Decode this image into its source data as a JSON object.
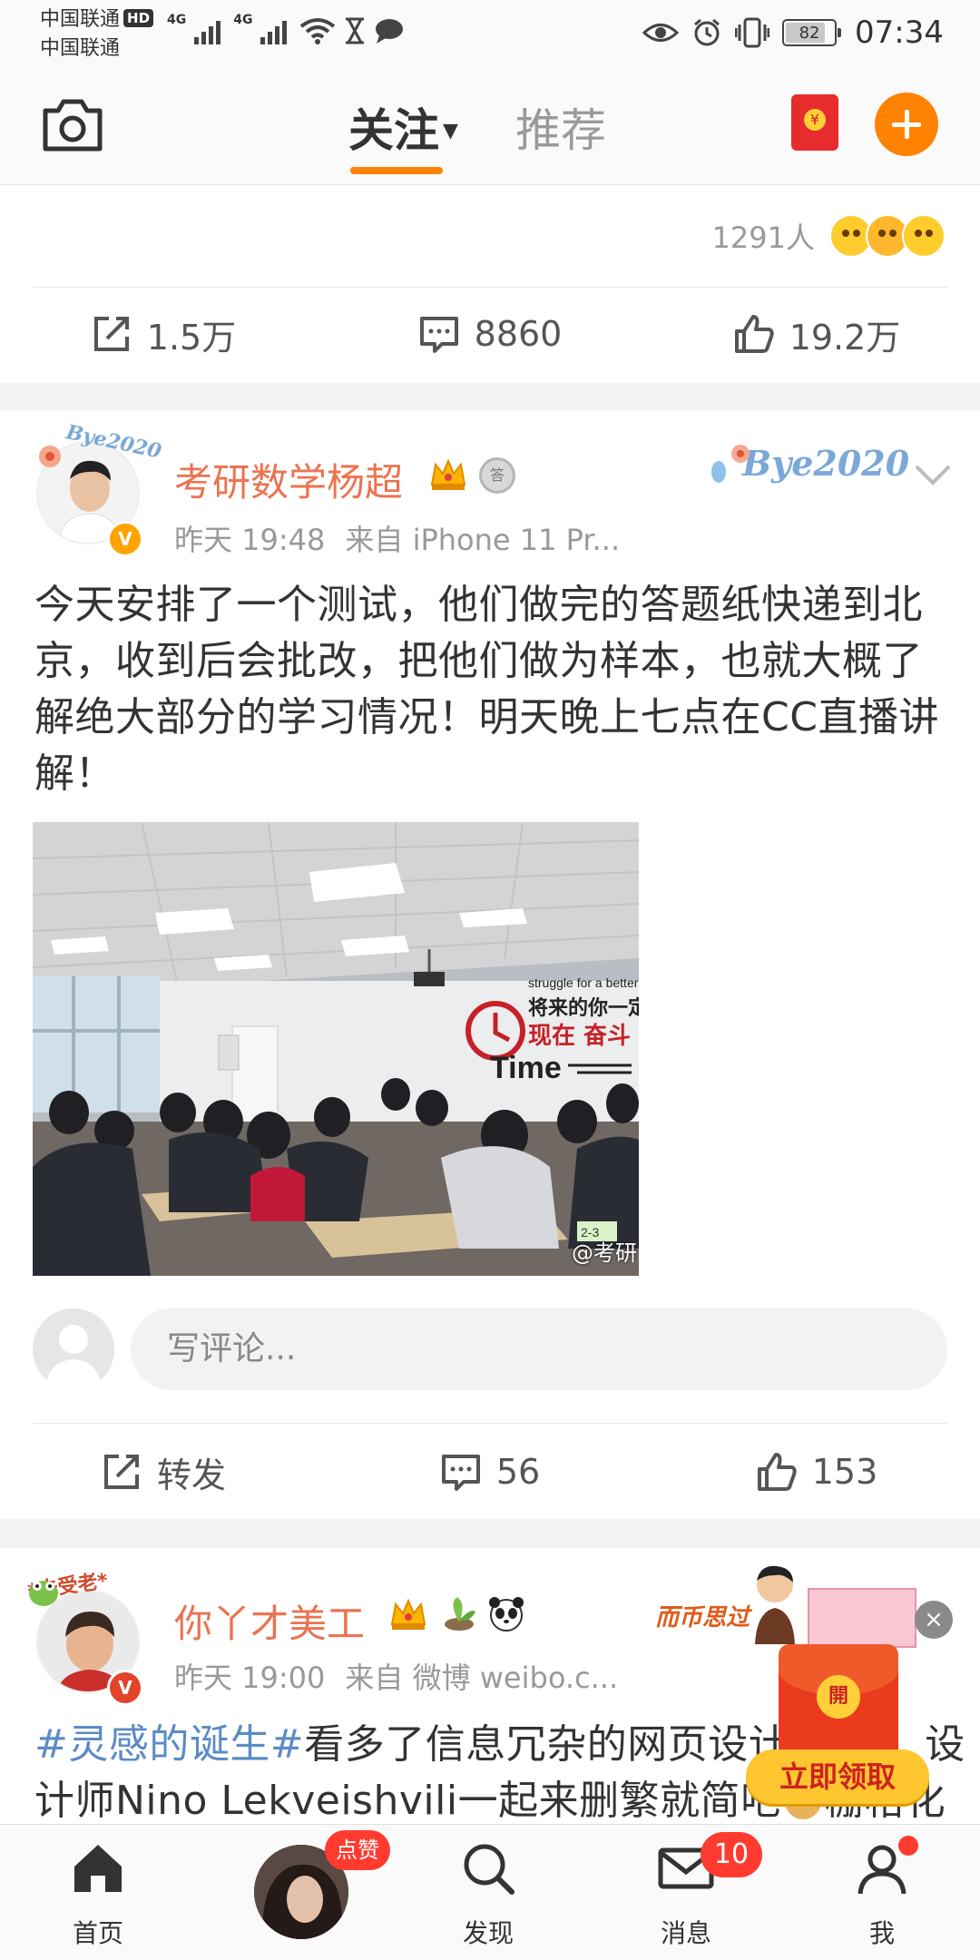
{
  "status_bar": {
    "carrier_1": "中国联通",
    "carrier_1_badge": "HD",
    "carrier_2": "中国联通",
    "network_1": "4G",
    "network_2": "4G",
    "battery": "82",
    "battery_level": 0.82,
    "time": "07:34"
  },
  "top_nav": {
    "tab_follow": "关注",
    "tab_recommend": "推荐",
    "accent_color": "#ff8200"
  },
  "post_prev": {
    "reaction_count": "1291人",
    "repost": "1.5万",
    "comments": "8860",
    "likes": "19.2万"
  },
  "post_main": {
    "author": "考研数学杨超",
    "avatar_tag": "Bye2020",
    "decoration_tag": "Bye2020",
    "verified_badge": "V",
    "medal": "答",
    "time": "昨天 19:48",
    "source": "来自 iPhone 11 Pr...",
    "text": "今天安排了一个测试，他们做完的答题纸快递到北京，收到后会批改，把他们做为样本，也就大概了解绝大部分的学习情况！明天晚上七点在CC直播讲解！",
    "photo": {
      "wall_slogan_1": "struggle for a better",
      "wall_slogan_2": "将来的你一定",
      "wall_slogan_3": "现在 奋斗",
      "wall_word": "Time",
      "desk_number": "2-3",
      "watermark": "@考研"
    },
    "comment_placeholder": "写评论...",
    "repost_label": "转发",
    "comments": "56",
    "likes": "153"
  },
  "post_next": {
    "author": "你丫才美工",
    "avatar_tag": "*未受老*",
    "verified_badge": "V",
    "time": "昨天 19:00",
    "source": "来自 微博 weibo.c...",
    "hashtag": "#灵感的诞生#",
    "text_1": "看多了信息冗杂的网页设计",
    "text_1_tail": "设",
    "text_2": "计师Nino Lekveishvili一起来删繁就简吧",
    "text_2_tail": "栅格化"
  },
  "ad": {
    "banner_text": "而币思过",
    "close": "×",
    "open_char": "開",
    "claim_button": "立即领取"
  },
  "tab_bar": {
    "home": "首页",
    "like_badge": "点赞",
    "discover": "发现",
    "messages": "消息",
    "messages_badge": "10",
    "me": "我"
  }
}
